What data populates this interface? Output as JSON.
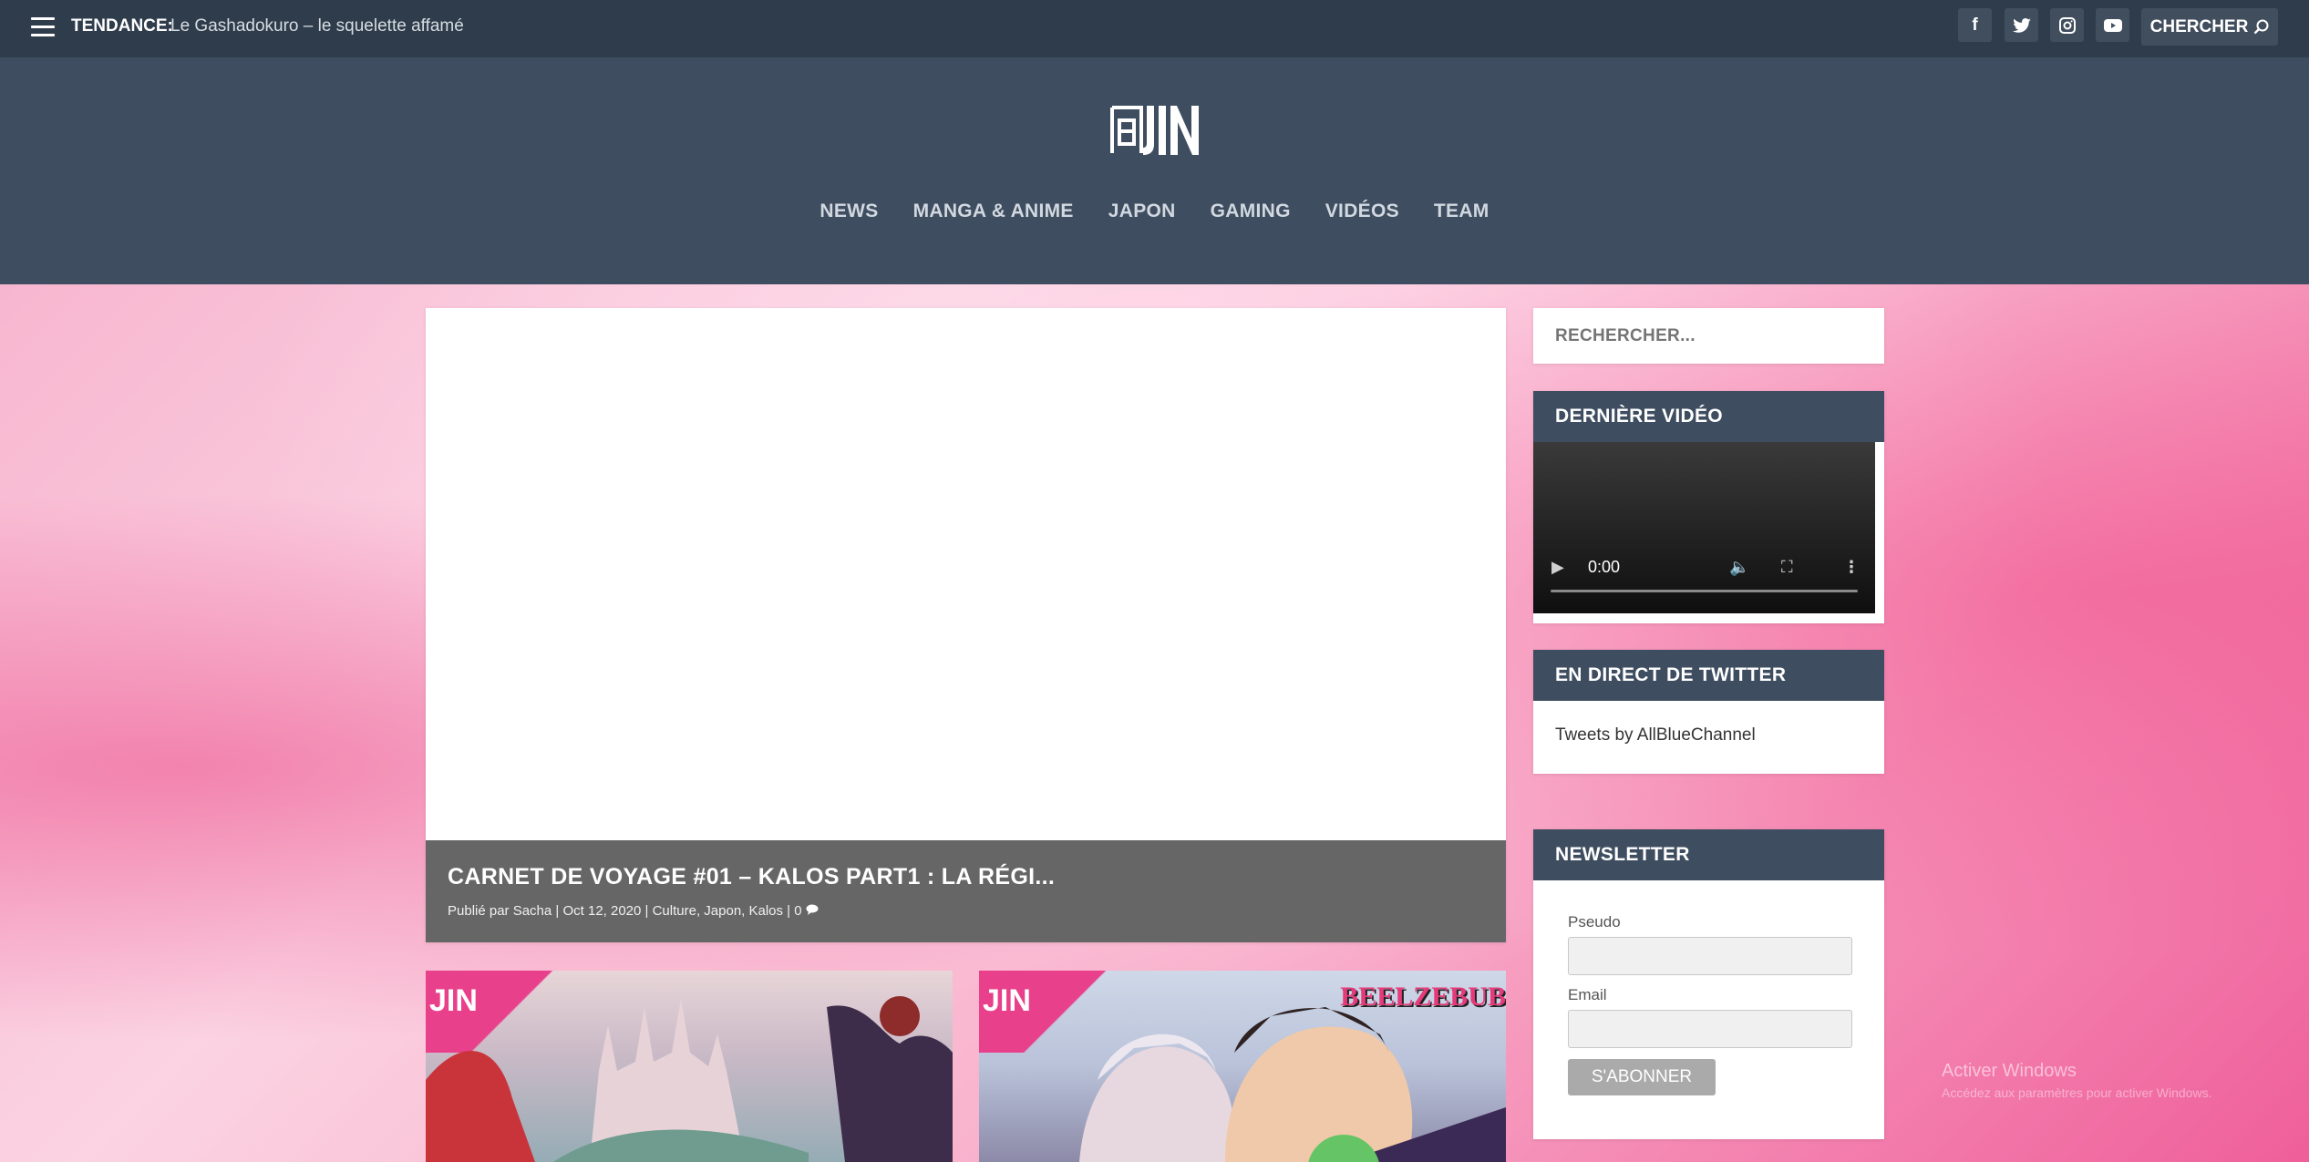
{
  "topbar": {
    "trend_label": "TENDANCE:",
    "trend_link": "Le Gashadokuro – le squelette affamé",
    "social": [
      {
        "icon": "facebook-icon",
        "glyph": "f"
      },
      {
        "icon": "twitter-icon",
        "glyph": "🐦"
      },
      {
        "icon": "instagram-icon",
        "glyph": "◙"
      },
      {
        "icon": "youtube-icon",
        "glyph": "▶"
      }
    ],
    "search_label": "CHERCHER"
  },
  "nav": {
    "items": [
      "NEWS",
      "MANGA & ANIME",
      "JAPON",
      "GAMING",
      "VIDÉOS",
      "TEAM"
    ]
  },
  "featured": {
    "title": "CARNET DE VOYAGE #01 – KALOS PART1 : LA RÉGI...",
    "meta": "Publié par Sacha | Oct 12, 2020 | Culture, Japon, Kalos | 0"
  },
  "thumbs": [
    {
      "logo": "JIN"
    },
    {
      "logo": "JIN",
      "title_art": "BEELZEBUB"
    }
  ],
  "sidebar": {
    "search_placeholder": "RECHERCHER...",
    "video_title": "DERNIÈRE VIDÉO",
    "video_time": "0:00",
    "twitter_title": "EN DIRECT DE TWITTER",
    "twitter_text": "Tweets by AllBlueChannel",
    "newsletter_title": "NEWSLETTER",
    "pseudo_label": "Pseudo",
    "email_label": "Email",
    "subscribe_label": "S'ABONNER"
  },
  "watermark": {
    "line1": "Activer Windows",
    "line2": "Accédez aux paramètres pour activer Windows."
  }
}
